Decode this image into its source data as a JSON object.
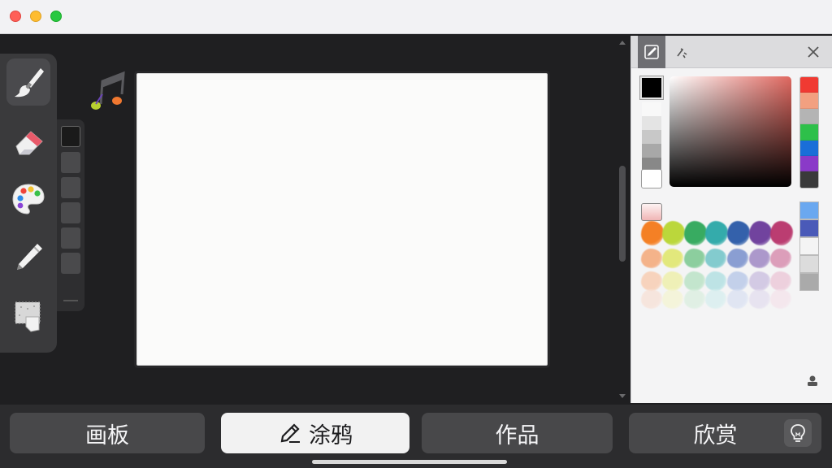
{
  "window": {
    "controls": [
      "close",
      "minimize",
      "maximize"
    ]
  },
  "tools": [
    {
      "name": "brush",
      "icon": "paintbrush-icon",
      "active": true
    },
    {
      "name": "eraser",
      "icon": "eraser-icon",
      "active": false
    },
    {
      "name": "palette",
      "icon": "palette-icon",
      "active": false
    },
    {
      "name": "pen",
      "icon": "pen-icon",
      "active": false
    },
    {
      "name": "texture",
      "icon": "texture-paper-icon",
      "active": false
    }
  ],
  "layers": {
    "count": 6,
    "active_index": 0
  },
  "color_panel": {
    "tabs": [
      {
        "icon": "brush-color-icon",
        "active": true
      },
      {
        "icon": "sparkle-icon",
        "active": false
      }
    ],
    "current_color": "#000000",
    "picker_hue": "#e06860",
    "gray_ramp": [
      "#f8f8f8",
      "#e4e4e4",
      "#c8c8c8",
      "#a8a8a8",
      "#888888",
      "#5a5a5a"
    ],
    "hue_swatches": [
      "#f03a32",
      "#f2a080",
      "#b4b4b4",
      "#2ec04a",
      "#1a6ed8",
      "#8a3ac8",
      "#3a3a3a"
    ],
    "paint_colors": {
      "row1": [
        "#f57a1a",
        "#b8d632",
        "#2ea85a",
        "#2aa8a8",
        "#2a5aa8",
        "#6a3a9a",
        "#b8346a"
      ],
      "row2": [
        "#f5a878",
        "#e0e668",
        "#7ac890",
        "#70c4c8",
        "#7890cc",
        "#a088c4",
        "#d890b0"
      ],
      "row3": [
        "#f8ccb0",
        "#eef0a8",
        "#b8e2c4",
        "#b0e0e2",
        "#b8c8e8",
        "#ccc0e0",
        "#ecc8d8"
      ],
      "row4": [
        "#f8e0d4",
        "#f4f4d0",
        "#d8eede",
        "#d4eeee",
        "#d8e0f2",
        "#e2dcee",
        "#f4e2ea"
      ]
    },
    "side_swatches": [
      "#6aa8f0",
      "#4a5ab8",
      "#f4f4f4",
      "#dcdcdc",
      "#aaaaaa"
    ]
  },
  "bottom_tabs": [
    {
      "label": "画板",
      "active": false
    },
    {
      "label": "涂鸦",
      "active": true
    },
    {
      "label": "作品",
      "active": false
    },
    {
      "label": "欣赏",
      "active": false
    }
  ]
}
